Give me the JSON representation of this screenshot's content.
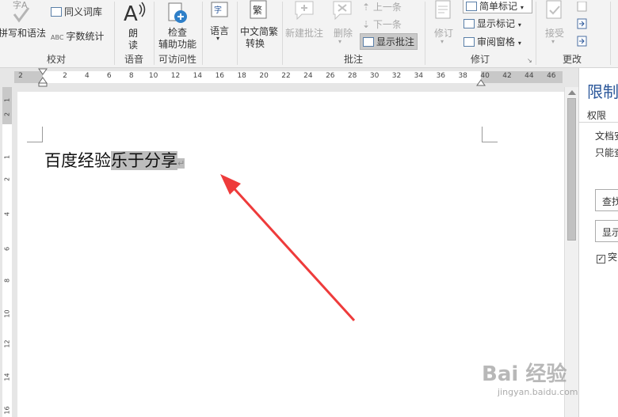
{
  "ribbon": {
    "proofing": {
      "label": "校对",
      "spelling": "拼写和语法",
      "thesaurus": "同义词库",
      "wordcount": "字数统计",
      "wordcount_icon_text": "ABC"
    },
    "speech": {
      "label": "语音",
      "read_line1": "朗",
      "read_line2": "读"
    },
    "accessibility": {
      "label": "可访问性",
      "check_line1": "检查",
      "check_line2": "辅助功能"
    },
    "language": {
      "label": "语言"
    },
    "chinese": {
      "convert_line1": "中文简繁",
      "convert_line2": "转换",
      "icon_text": "繁"
    },
    "comments": {
      "label": "批注",
      "new": "新建批注",
      "delete": "删除",
      "previous": "上一条",
      "next": "下一条",
      "show": "显示批注"
    },
    "tracking": {
      "label": "修订",
      "track": "修订",
      "simple_markup": "简单标记",
      "show_markup": "显示标记",
      "review_pane": "审阅窗格"
    },
    "changes": {
      "label": "更改",
      "accept": "接受"
    }
  },
  "ruler": {
    "left_ticks": [
      "2"
    ],
    "ticks": [
      "2",
      "4",
      "6",
      "8",
      "10",
      "12",
      "14",
      "16",
      "18",
      "20",
      "22",
      "24",
      "26",
      "28",
      "30",
      "32",
      "34",
      "36",
      "38",
      "40",
      "42",
      "44",
      "46"
    ],
    "vticks": [
      "2",
      "1",
      "1",
      "2",
      "4",
      "6",
      "8",
      "10",
      "12",
      "14",
      "16"
    ]
  },
  "document": {
    "text_plain": "百度经验",
    "text_selected": "乐于分享",
    "para_mark": "↵"
  },
  "pane": {
    "title": "限制",
    "permissions": "权限",
    "line1": "文档安",
    "line2": "只能查",
    "find_button": "查找",
    "show_button": "显示",
    "highlight_checkbox": "突"
  },
  "watermark": {
    "logo": "Bai 经验",
    "url": "jingyan.baidu.com"
  },
  "colors": {
    "accent": "#2b579a",
    "arrow": "#ee3b3b",
    "selection": "#bdbdbd"
  }
}
